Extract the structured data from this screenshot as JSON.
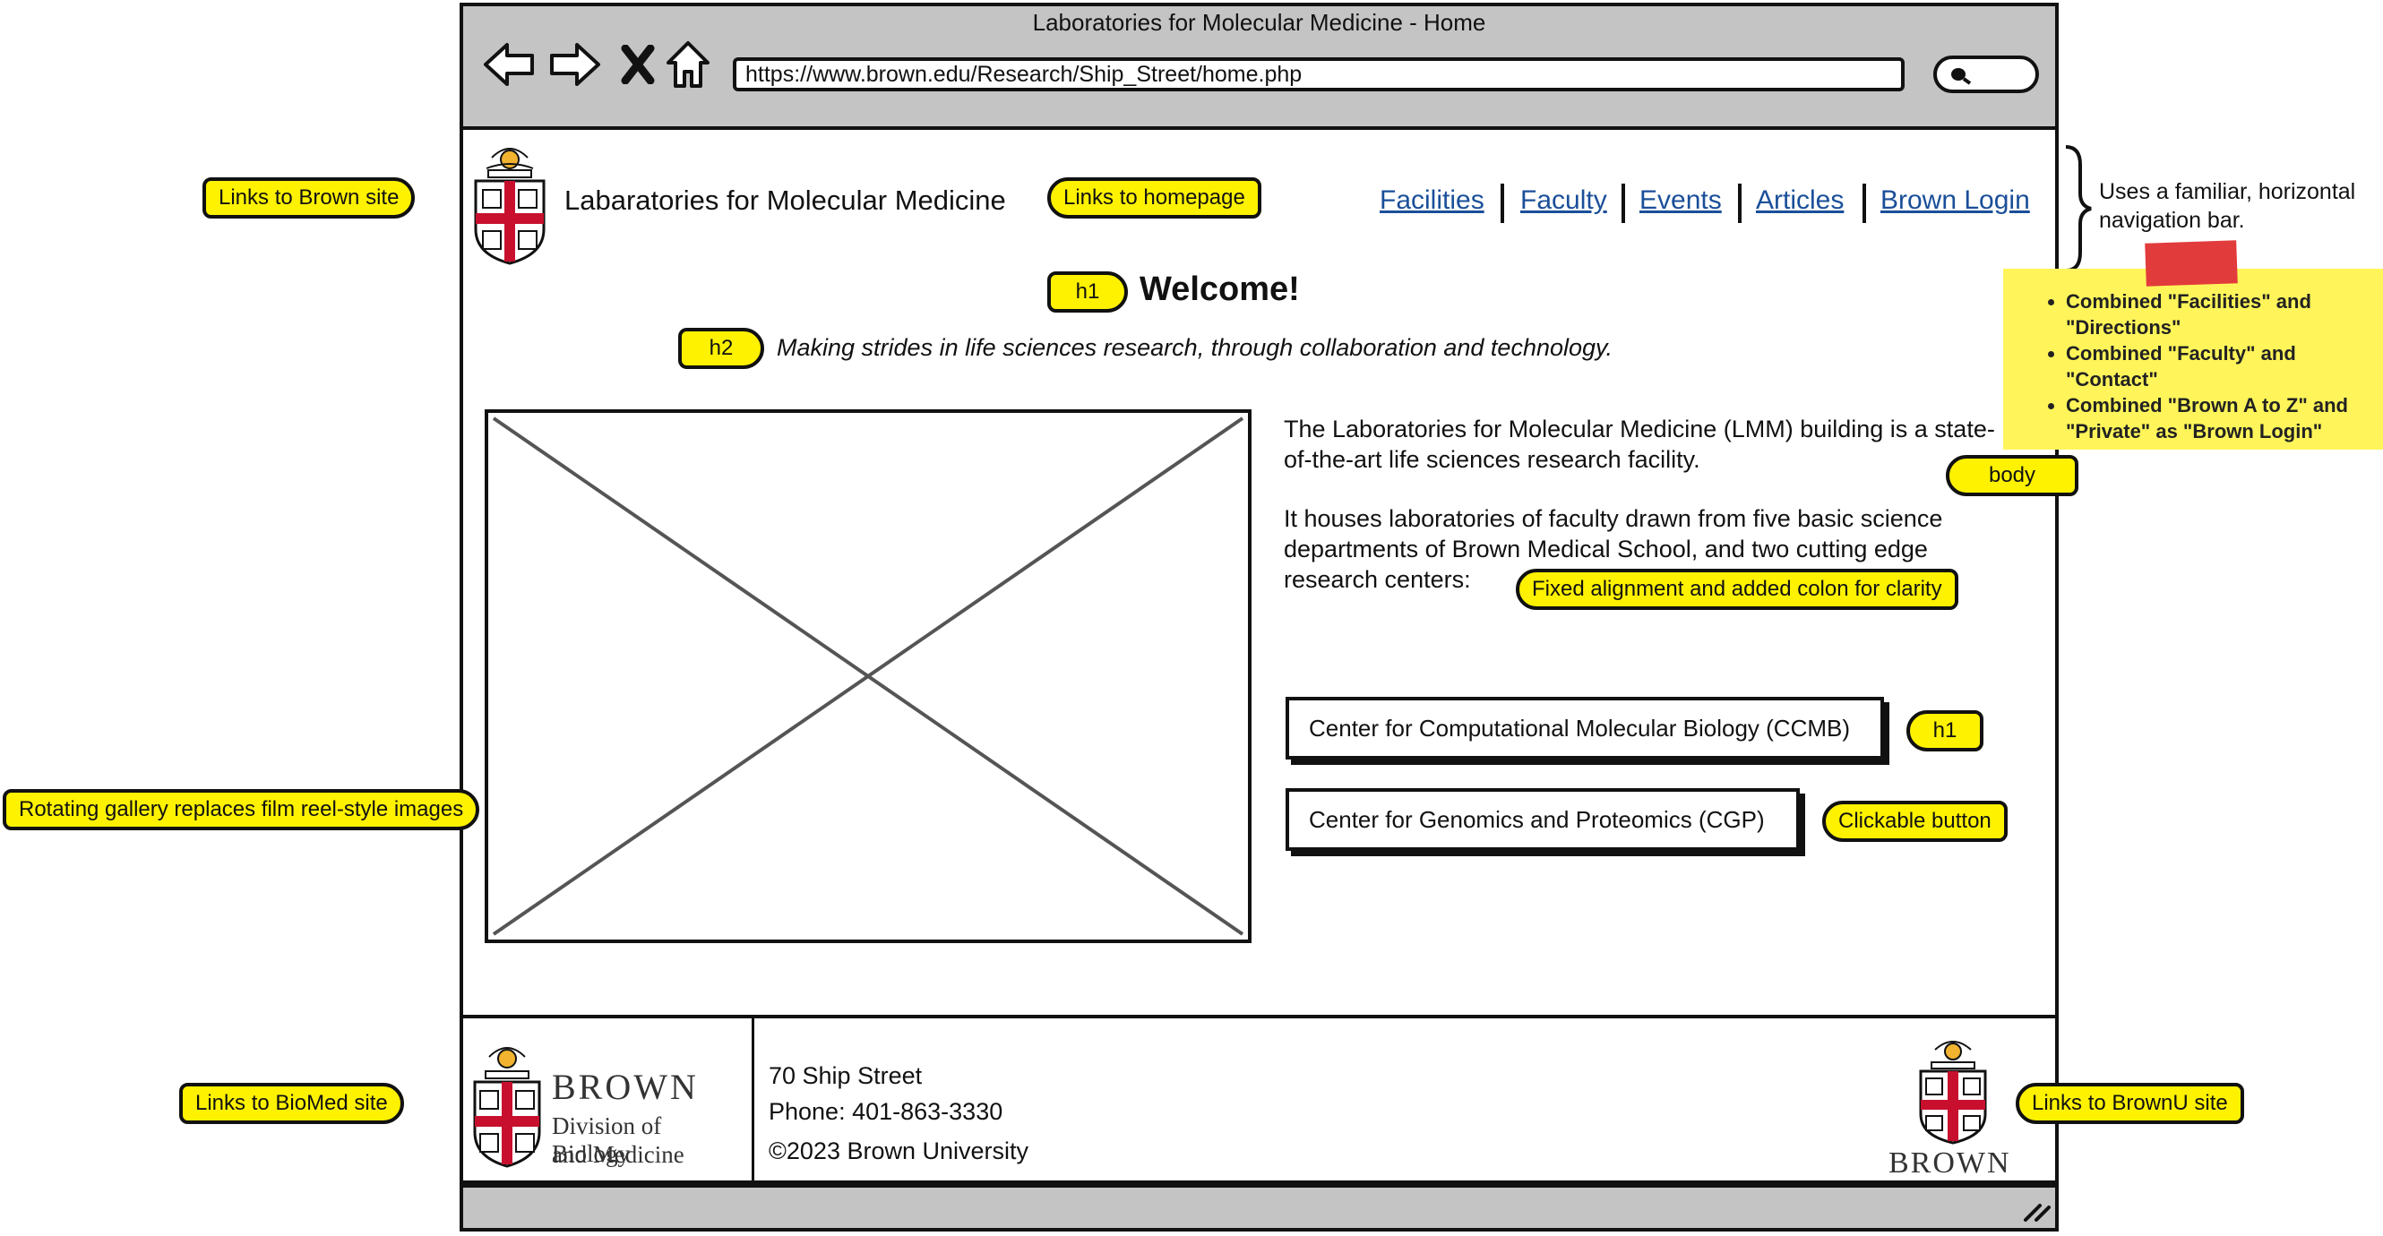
{
  "browser": {
    "title": "Laboratories for Molecular Medicine - Home",
    "url": "https://www.brown.edu/Research/Ship_Street/home.php"
  },
  "header": {
    "site_title": "Labaratories for Molecular Medicine",
    "nav": [
      "Facilities",
      "Faculty",
      "Events",
      "Articles",
      "Brown Login"
    ]
  },
  "main": {
    "welcome": "Welcome!",
    "tagline": "Making strides in life sciences research, through collaboration and technology.",
    "para1": "The Laboratories for Molecular Medicine (LMM) building is a state-of-the-art life sciences research facility.",
    "para2": "It houses laboratories of faculty drawn from five basic science departments of Brown Medical School, and two cutting edge research centers:",
    "buttons": [
      "Center for Computational Molecular Biology (CCMB)",
      "Center for Genomics and Proteomics (CGP)"
    ]
  },
  "footer": {
    "logo_brown": "BROWN",
    "logo_division_1": "Division of Biology",
    "logo_division_2": "and Medicine",
    "address": "70 Ship Street",
    "phone": "Phone: 401-863-3330",
    "copyright": "©2023 Brown University",
    "right_logo_text": "BROWN"
  },
  "annotations": {
    "links_brown_site": "Links to Brown site",
    "links_homepage": "Links to homepage",
    "h1_welcome": "h1",
    "h2_tagline": "h2",
    "body": "body",
    "fixed_alignment": "Fixed alignment and added colon for clarity",
    "h1_button": "h1",
    "clickable_button": "Clickable button",
    "rotating_gallery": "Rotating gallery replaces film reel-style images",
    "links_biomed": "Links to BioMed site",
    "links_brownu": "Links to BrownU site",
    "nav_note": "Uses a familiar, horizontal navigation bar.",
    "sticky_items": [
      "Combined \"Facilities\" and \"Directions\"",
      "Combined \"Faculty\" and \"Contact\"",
      "Combined \"Brown A to Z\" and \"Private\" as \"Brown Login\""
    ]
  },
  "colors": {
    "chrome_gray": "#c4c4c4",
    "link_blue": "#1a4f99",
    "annotation_yellow": "#fff200",
    "sticky_yellow": "#fff55a",
    "brown_red": "#c8102e"
  }
}
